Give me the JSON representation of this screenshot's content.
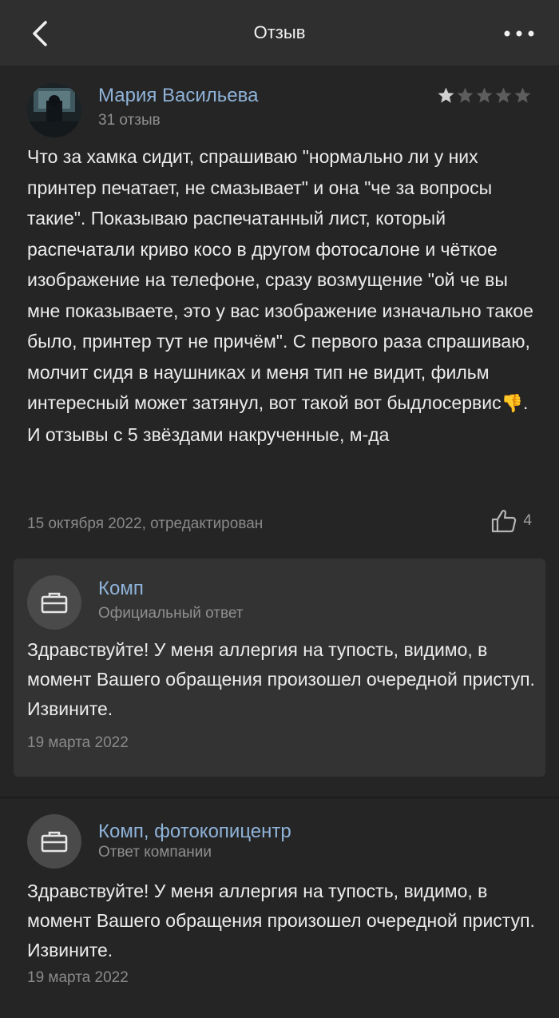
{
  "header": {
    "title": "Отзыв",
    "back_icon": "chevron-left-icon",
    "more_icon": "more-dots-icon"
  },
  "review": {
    "author": "Мария Васильева",
    "reviews_count": "31 отзыв",
    "rating": 1,
    "rating_max": 5,
    "text": "Что за хамка сидит, спрашиваю \"нормально ли у них принтер печатает, не смазывает\" и она \"че за вопросы такие\". Показываю распечатанный лист, который распечатали криво косо в другом фотосалоне и чёткое изображение на телефоне, сразу возмущение \"ой че вы мне показываете, это у вас изображение изначально такое было, принтер тут не причём\". С первого раза спрашиваю, молчит сидя в наушниках и меня тип не видит, фильм интересный может затянул, вот такой вот быдлосервис",
    "emoji": "👎",
    "text_tail": ". И отзывы с 5 звёздами накрученные, м-да",
    "meta": "15 октября 2022, отредактирован",
    "likes": "4"
  },
  "official_reply": {
    "org": "Комп",
    "label": "Официальный ответ",
    "text": "Здравствуйте! У меня аллергия на тупость, видимо, в момент Вашего обращения произошел очередной приступ. Извините.",
    "date": "19 марта 2022"
  },
  "company_reply": {
    "org": "Комп, фотокопицентр",
    "label": "Ответ компании",
    "text": "Здравствуйте! У меня аллергия на тупость, видимо, в момент Вашего обращения произошел очередной приступ. Извините.",
    "date": "19 марта 2022"
  },
  "colors": {
    "background": "#252525",
    "header": "#2f2f2f",
    "card": "#333333",
    "link": "#8fb3d9",
    "star_on": "#cfcfcf",
    "star_off": "#5d5d5d"
  }
}
